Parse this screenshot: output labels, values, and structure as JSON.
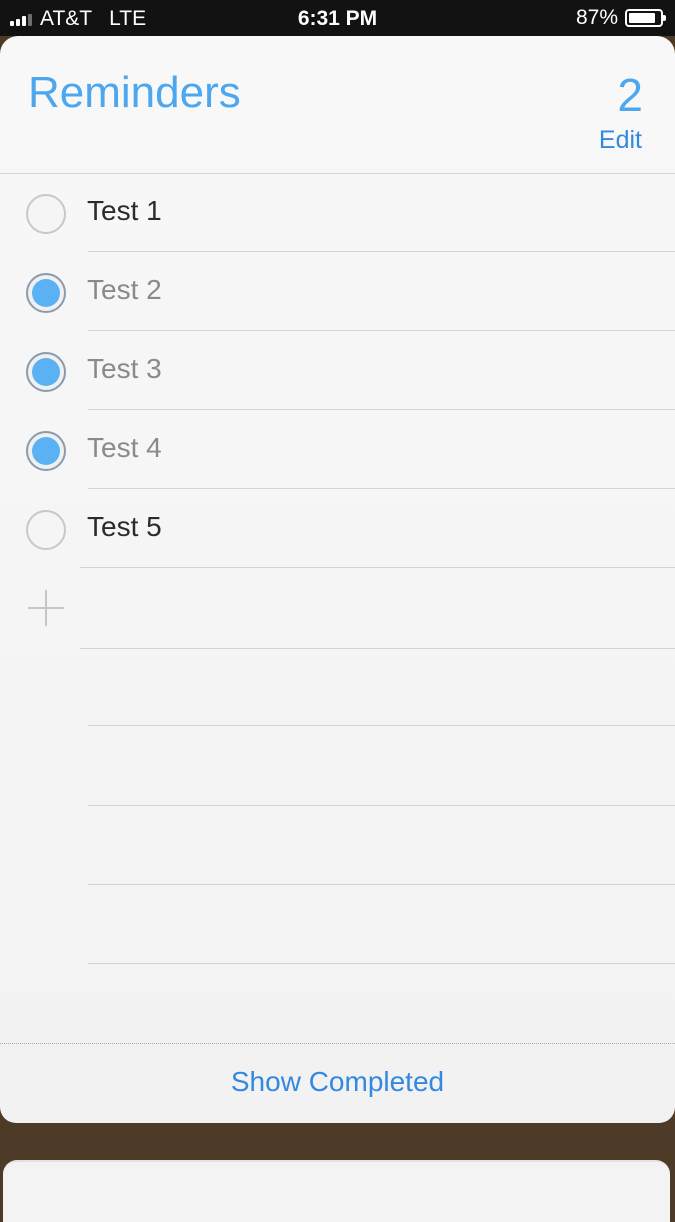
{
  "status_bar": {
    "carrier": "AT&T",
    "network": "LTE",
    "time": "6:31 PM",
    "battery_percent": "87%",
    "battery_level": 0.87,
    "signal_bars": 3
  },
  "list": {
    "title": "Reminders",
    "count": "2",
    "edit_label": "Edit",
    "accent_color": "#4da7ee",
    "items": [
      {
        "label": "Test 1",
        "completed": false
      },
      {
        "label": "Test 2",
        "completed": true
      },
      {
        "label": "Test 3",
        "completed": true
      },
      {
        "label": "Test 4",
        "completed": true
      },
      {
        "label": "Test 5",
        "completed": false
      }
    ],
    "add_icon": "plus-icon",
    "show_completed_label": "Show Completed"
  }
}
